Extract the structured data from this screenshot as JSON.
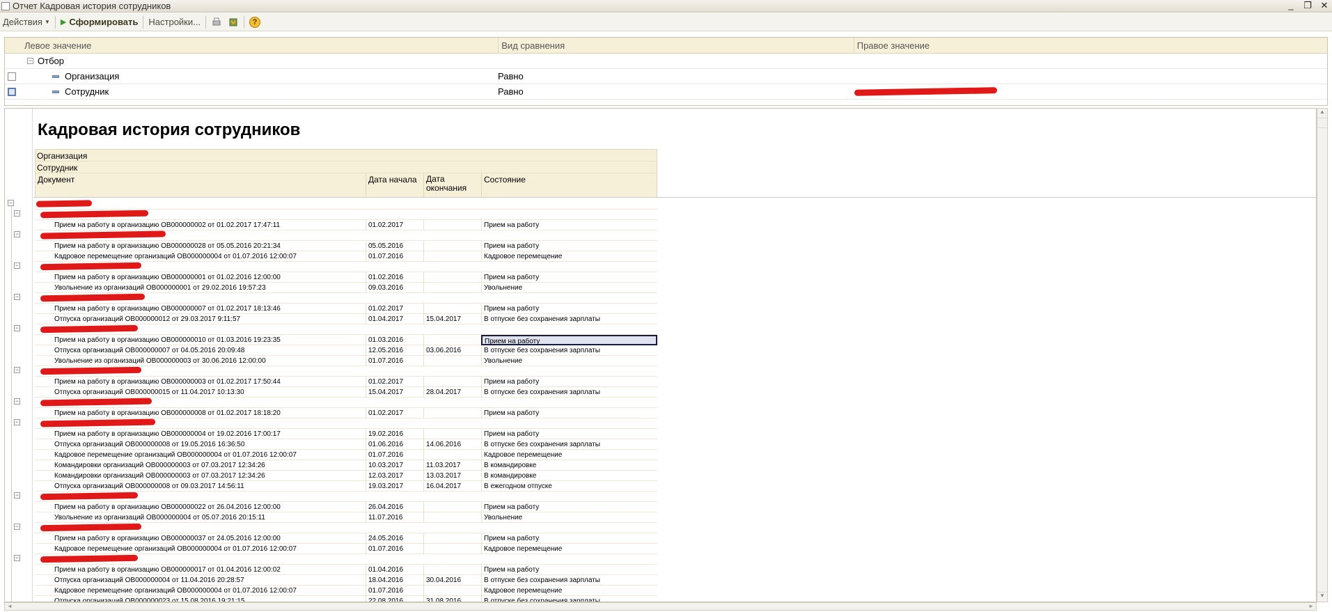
{
  "window": {
    "title": "Отчет  Кадровая история сотрудников",
    "buttons": [
      "_",
      "❐",
      "✕"
    ]
  },
  "toolbar": {
    "actions_label": "Действия",
    "generate_label": "Сформировать",
    "settings_label": "Настройки...",
    "help_label": "?"
  },
  "filter": {
    "columns": [
      "Левое значение",
      "Вид сравнения",
      "Правое значение"
    ],
    "group_label": "Отбор",
    "rows": [
      {
        "field": "Организация",
        "comparison": "Равно"
      },
      {
        "field": "Сотрудник",
        "comparison": "Равно"
      }
    ]
  },
  "report": {
    "title": "Кадровая история сотрудников",
    "header_org": "Организация",
    "header_emp": "Сотрудник",
    "col_doc": "Документ",
    "col_start": "Дата начала",
    "col_end": "Дата окончания",
    "col_state": "Состояние",
    "rows": [
      {
        "g": 1
      },
      {
        "g": 2
      },
      {
        "doc": "Прием на работу в организацию ОВ000000002 от 01.02.2017 17:47:11",
        "start": "01.02.2017",
        "end": "",
        "state": "Прием на работу"
      },
      {
        "g": 2
      },
      {
        "doc": "Прием на работу в организацию ОВ000000028 от 05.05.2016 20:21:34",
        "start": "05.05.2016",
        "end": "",
        "state": "Прием на работу"
      },
      {
        "doc": "Кадровое перемещение организаций ОВ000000004 от 01.07.2016 12:00:07",
        "start": "01.07.2016",
        "end": "",
        "state": "Кадровое перемещение"
      },
      {
        "g": 2
      },
      {
        "doc": "Прием на работу в организацию ОВ000000001 от 01.02.2016 12:00:00",
        "start": "01.02.2016",
        "end": "",
        "state": "Прием на работу"
      },
      {
        "doc": "Увольнение из организаций ОВ000000001 от 29.02.2016 19:57:23",
        "start": "09.03.2016",
        "end": "",
        "state": "Увольнение"
      },
      {
        "g": 2
      },
      {
        "doc": "Прием на работу в организацию ОВ000000007 от 01.02.2017 18:13:46",
        "start": "01.02.2017",
        "end": "",
        "state": "Прием на работу"
      },
      {
        "doc": "Отпуска организаций ОВ000000012 от 29.03.2017 9:11:57",
        "start": "01.04.2017",
        "end": "15.04.2017",
        "state": "В отпуске без сохранения зарплаты"
      },
      {
        "g": 2
      },
      {
        "doc": "Прием на работу в организацию ОВ000000010 от 01.03.2016 19:23:35",
        "start": "01.03.2016",
        "end": "",
        "state": "Прием на работу",
        "selected": true
      },
      {
        "doc": "Отпуска организаций ОВ000000007 от 04.05.2016 20:09:48",
        "start": "12.05.2016",
        "end": "03.06.2016",
        "state": "В отпуске без сохранения зарплаты"
      },
      {
        "doc": "Увольнение из организаций ОВ000000003 от 30.06.2016 12:00:00",
        "start": "01.07.2016",
        "end": "",
        "state": "Увольнение"
      },
      {
        "g": 2
      },
      {
        "doc": "Прием на работу в организацию ОВ000000003 от 01.02.2017 17:50:44",
        "start": "01.02.2017",
        "end": "",
        "state": "Прием на работу"
      },
      {
        "doc": "Отпуска организаций ОВ000000015 от 11.04.2017 10:13:30",
        "start": "15.04.2017",
        "end": "28.04.2017",
        "state": "В отпуске без сохранения зарплаты"
      },
      {
        "g": 2
      },
      {
        "doc": "Прием на работу в организацию ОВ000000008 от 01.02.2017 18:18:20",
        "start": "01.02.2017",
        "end": "",
        "state": "Прием на работу"
      },
      {
        "g": 2
      },
      {
        "doc": "Прием на работу в организацию ОВ000000004 от 19.02.2016 17:00:17",
        "start": "19.02.2016",
        "end": "",
        "state": "Прием на работу"
      },
      {
        "doc": "Отпуска организаций ОВ000000008 от 19.05.2016 16:36:50",
        "start": "01.06.2016",
        "end": "14.06.2016",
        "state": "В отпуске без сохранения зарплаты"
      },
      {
        "doc": "Кадровое перемещение организаций ОВ000000004 от 01.07.2016 12:00:07",
        "start": "01.07.2016",
        "end": "",
        "state": "Кадровое перемещение"
      },
      {
        "doc": "Командировки организаций ОВ000000003 от 07.03.2017 12:34:26",
        "start": "10.03.2017",
        "end": "11.03.2017",
        "state": "В командировке"
      },
      {
        "doc": "Командировки организаций ОВ000000003 от 07.03.2017 12:34:26",
        "start": "12.03.2017",
        "end": "13.03.2017",
        "state": "В командировке"
      },
      {
        "doc": "Отпуска организаций ОВ000000008 от 09.03.2017 14:56:11",
        "start": "19.03.2017",
        "end": "16.04.2017",
        "state": "В ежегодном отпуске"
      },
      {
        "g": 2
      },
      {
        "doc": "Прием на работу в организацию ОВ000000022 от 26.04.2016 12:00:00",
        "start": "26.04.2016",
        "end": "",
        "state": "Прием на работу"
      },
      {
        "doc": "Увольнение из организаций ОВ000000004 от 05.07.2016 20:15:11",
        "start": "11.07.2016",
        "end": "",
        "state": "Увольнение"
      },
      {
        "g": 2
      },
      {
        "doc": "Прием на работу в организацию ОВ000000037 от 24.05.2016 12:00:00",
        "start": "24.05.2016",
        "end": "",
        "state": "Прием на работу"
      },
      {
        "doc": "Кадровое перемещение организаций ОВ000000004 от 01.07.2016 12:00:07",
        "start": "01.07.2016",
        "end": "",
        "state": "Кадровое перемещение"
      },
      {
        "g": 2
      },
      {
        "doc": "Прием на работу в организацию ОВ000000017 от 01.04.2016 12:00:02",
        "start": "01.04.2016",
        "end": "",
        "state": "Прием на работу"
      },
      {
        "doc": "Отпуска организаций ОВ000000004 от 11.04.2016 20:28:57",
        "start": "18.04.2016",
        "end": "30.04.2016",
        "state": "В отпуске без сохранения зарплаты"
      },
      {
        "doc": "Кадровое перемещение организаций ОВ000000004 от 01.07.2016 12:00:07",
        "start": "01.07.2016",
        "end": "",
        "state": "Кадровое перемещение"
      },
      {
        "doc": "Отпуска организаций ОВ000000023 от 15.08.2016 19:21:15",
        "start": "22.08.2016",
        "end": "31.08.2016",
        "state": "В отпуске без сохранения зарплаты"
      }
    ]
  }
}
